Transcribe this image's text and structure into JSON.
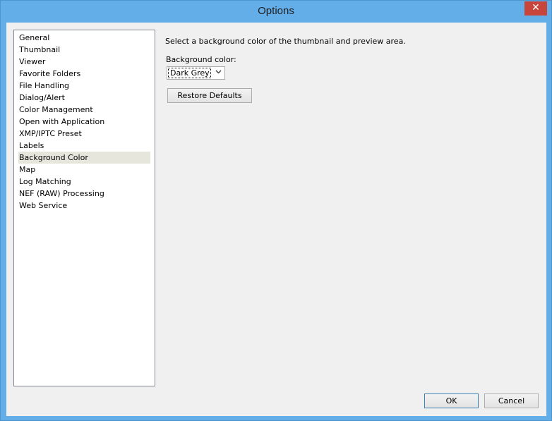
{
  "window": {
    "title": "Options",
    "close_glyph": "✕"
  },
  "nav": {
    "items": [
      {
        "label": "General"
      },
      {
        "label": "Thumbnail"
      },
      {
        "label": "Viewer"
      },
      {
        "label": "Favorite Folders"
      },
      {
        "label": "File Handling"
      },
      {
        "label": "Dialog/Alert"
      },
      {
        "label": "Color Management"
      },
      {
        "label": "Open with Application"
      },
      {
        "label": "XMP/IPTC Preset"
      },
      {
        "label": "Labels"
      },
      {
        "label": "Background Color"
      },
      {
        "label": "Map"
      },
      {
        "label": "Log Matching"
      },
      {
        "label": "NEF (RAW) Processing"
      },
      {
        "label": "Web Service"
      }
    ],
    "selected": "Background Color"
  },
  "panel": {
    "description": "Select a background color of the thumbnail and preview area.",
    "bg_color_label": "Background color:",
    "bg_color_value": "Dark Grey",
    "restore_label": "Restore Defaults"
  },
  "footer": {
    "ok_label": "OK",
    "cancel_label": "Cancel"
  },
  "colors": {
    "titlebar": "#63aee8",
    "close": "#c7453a",
    "selection": "#e6e6dd"
  },
  "icons": {
    "close": "close-icon",
    "dropdown": "chevron-down-icon"
  }
}
